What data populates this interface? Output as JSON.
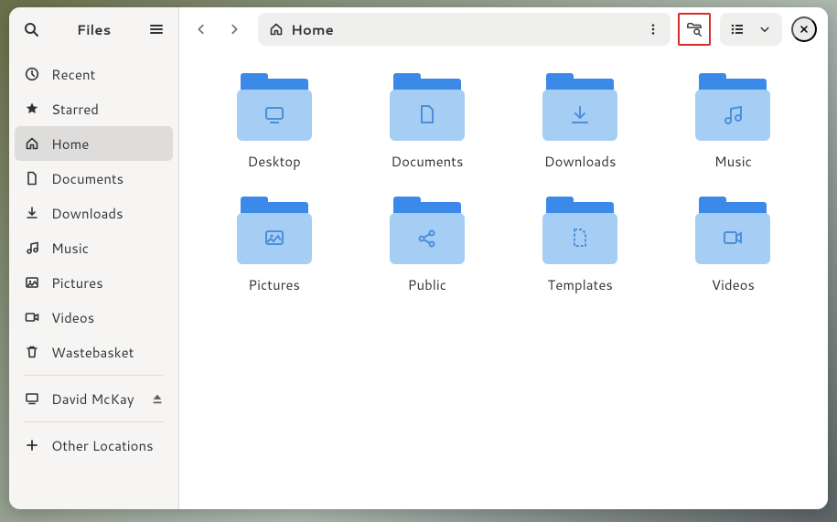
{
  "app": {
    "title": "Files"
  },
  "sidebar": {
    "items": [
      {
        "label": "Recent",
        "icon": "clock-icon"
      },
      {
        "label": "Starred",
        "icon": "star-icon"
      },
      {
        "label": "Home",
        "icon": "home-icon",
        "selected": true
      },
      {
        "label": "Documents",
        "icon": "document-icon"
      },
      {
        "label": "Downloads",
        "icon": "download-icon"
      },
      {
        "label": "Music",
        "icon": "music-icon"
      },
      {
        "label": "Pictures",
        "icon": "picture-icon"
      },
      {
        "label": "Videos",
        "icon": "video-icon"
      },
      {
        "label": "Wastebasket",
        "icon": "trash-icon"
      }
    ],
    "user_row": {
      "label": "David McKay"
    },
    "other": {
      "label": "Other Locations"
    }
  },
  "pathbar": {
    "location": "Home"
  },
  "folders": [
    {
      "label": "Desktop",
      "glyph": "desktop"
    },
    {
      "label": "Documents",
      "glyph": "document"
    },
    {
      "label": "Downloads",
      "glyph": "download"
    },
    {
      "label": "Music",
      "glyph": "music"
    },
    {
      "label": "Pictures",
      "glyph": "picture"
    },
    {
      "label": "Public",
      "glyph": "share"
    },
    {
      "label": "Templates",
      "glyph": "template"
    },
    {
      "label": "Videos",
      "glyph": "video"
    }
  ]
}
